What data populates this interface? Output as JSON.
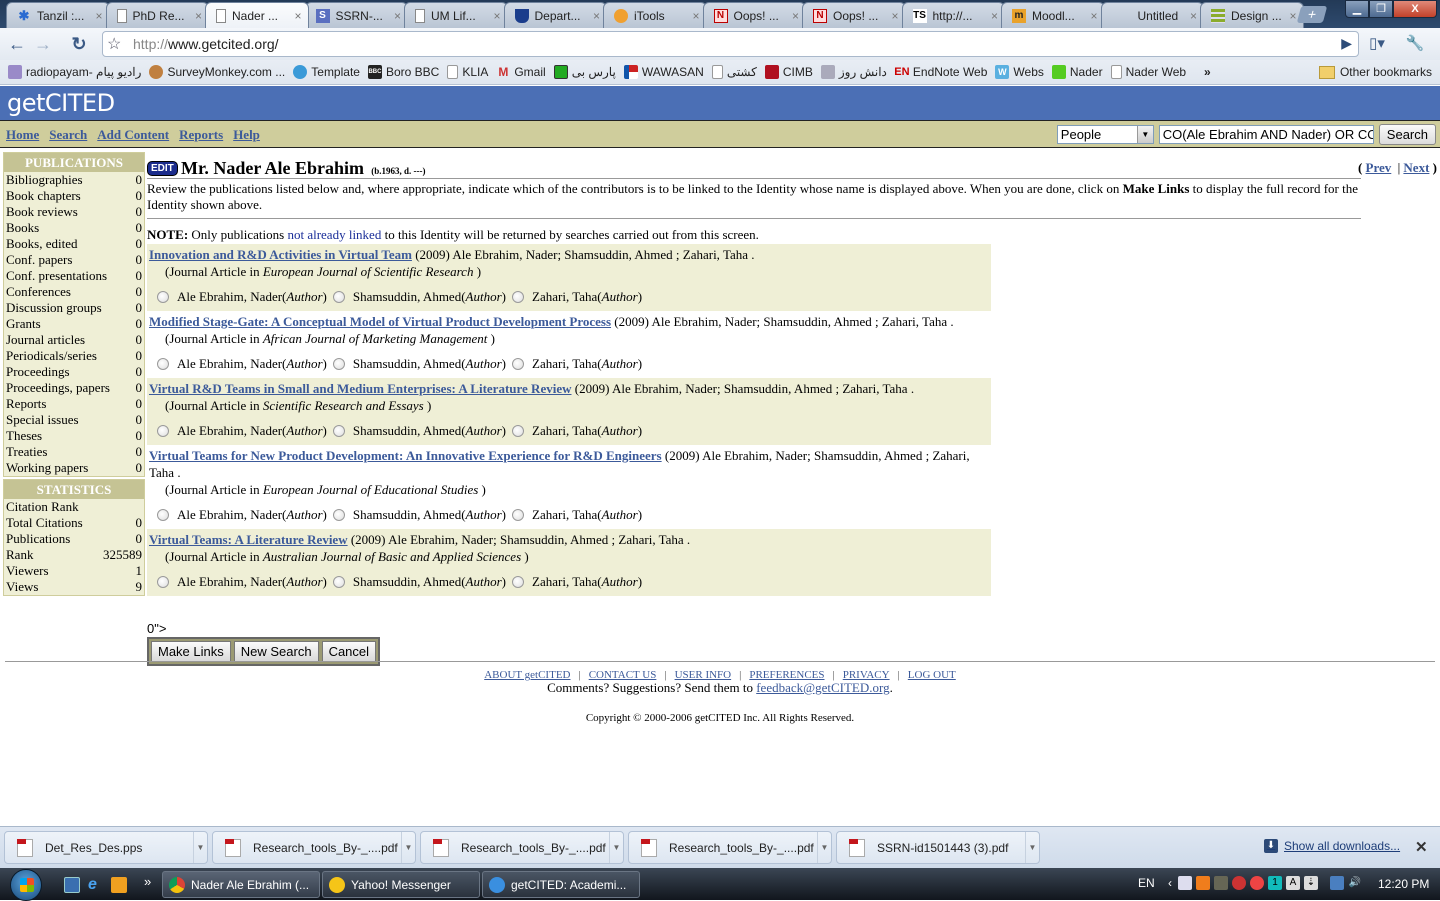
{
  "browser": {
    "tabs": [
      {
        "label": "Tanzil :...",
        "icon": "tanzil-icon",
        "active": false
      },
      {
        "label": "PhD Re...",
        "icon": "page-icon",
        "active": false
      },
      {
        "label": "Nader ...",
        "icon": "page-icon",
        "active": true
      },
      {
        "label": "SSRN-...",
        "icon": "ssrn-icon",
        "active": false
      },
      {
        "label": "UM Lif...",
        "icon": "page-icon",
        "active": false
      },
      {
        "label": "Depart...",
        "icon": "shield-icon",
        "active": false
      },
      {
        "label": "iTools",
        "icon": "itools-icon",
        "active": false
      },
      {
        "label": "Oops! ...",
        "icon": "nb-icon",
        "active": false
      },
      {
        "label": "Oops! ...",
        "icon": "nb-icon",
        "active": false
      },
      {
        "label": "http://...",
        "icon": "ts-icon",
        "active": false
      },
      {
        "label": "Moodl...",
        "icon": "moodle-icon",
        "active": false
      },
      {
        "label": "Untitled",
        "icon": "none",
        "active": false
      },
      {
        "label": "Design ...",
        "icon": "design-icon",
        "active": false
      }
    ],
    "new_tab_label": "+",
    "window_controls": {
      "minimize": "▁",
      "maximize": "❐",
      "close": "X"
    },
    "url_scheme": "http://",
    "url_rest": "www.getcited.org/",
    "bookmarks": [
      {
        "label": "radiopayam- رادیو پیام",
        "icon": "radio-icon"
      },
      {
        "label": "SurveyMonkey.com ...",
        "icon": "monkey-icon"
      },
      {
        "label": "Template",
        "icon": "template-icon"
      },
      {
        "label": "Boro BBC",
        "icon": "bbc-icon"
      },
      {
        "label": "KLIA",
        "icon": "page-icon"
      },
      {
        "label": "Gmail",
        "icon": "gmail-icon"
      },
      {
        "label": "پارس بی",
        "icon": "joomla-icon"
      },
      {
        "label": "WAWASAN",
        "icon": "flag-icon"
      },
      {
        "label": "کشتی",
        "icon": "page-icon"
      },
      {
        "label": "CIMB",
        "icon": "cimb-icon"
      },
      {
        "label": "دانش روز",
        "icon": "image-icon"
      },
      {
        "label": "EndNote Web",
        "icon": "endnote-icon"
      },
      {
        "label": "Webs",
        "icon": "webs-icon"
      },
      {
        "label": "Nader",
        "icon": "nader-icon"
      },
      {
        "label": "Nader Web",
        "icon": "page-icon"
      }
    ],
    "bookmarks_more": "»",
    "other_bookmarks": "Other bookmarks"
  },
  "site": {
    "logo": "getCITED",
    "nav": [
      "Home",
      "Search",
      "Add Content",
      "Reports",
      "Help"
    ],
    "search": {
      "category": "People",
      "query": "CO(Ale Ebrahim AND Nader) OR CO",
      "button": "Search"
    }
  },
  "sidebar": {
    "publications_header": "PUBLICATIONS",
    "publications": [
      {
        "label": "Bibliographies",
        "count": "0"
      },
      {
        "label": "Book chapters",
        "count": "0"
      },
      {
        "label": "Book reviews",
        "count": "0"
      },
      {
        "label": "Books",
        "count": "0"
      },
      {
        "label": "Books, edited",
        "count": "0"
      },
      {
        "label": "Conf. papers",
        "count": "0"
      },
      {
        "label": "Conf. presentations",
        "count": "0"
      },
      {
        "label": "Conferences",
        "count": "0"
      },
      {
        "label": "Discussion groups",
        "count": "0"
      },
      {
        "label": "Grants",
        "count": "0"
      },
      {
        "label": "Journal articles",
        "count": "0"
      },
      {
        "label": "Periodicals/series",
        "count": "0"
      },
      {
        "label": "Proceedings",
        "count": "0"
      },
      {
        "label": "Proceedings, papers",
        "count": "0"
      },
      {
        "label": "Reports",
        "count": "0"
      },
      {
        "label": "Special issues",
        "count": "0"
      },
      {
        "label": "Theses",
        "count": "0"
      },
      {
        "label": "Treaties",
        "count": "0"
      },
      {
        "label": "Working papers",
        "count": "0"
      }
    ],
    "statistics_header": "STATISTICS",
    "statistics": [
      {
        "label": "Citation Rank",
        "count": ""
      },
      {
        "label": "Total Citations",
        "count": "0"
      },
      {
        "label": "Publications",
        "count": "0"
      },
      {
        "label": "Rank",
        "count": "325589"
      },
      {
        "label": "Viewers",
        "count": "1"
      },
      {
        "label": "Views",
        "count": "9"
      }
    ]
  },
  "main": {
    "edit_badge": "EDIT",
    "person_name": "Mr. Nader Ale Ebrahim",
    "dates": "(b.1963, d. ---)",
    "prev_open": "(",
    "prev": "Prev",
    "separator": "|",
    "next": "Next",
    "prev_close": ")",
    "intro_a": "Review the publications listed below and, where appropriate, indicate which of the contributors is to be linked to the Identity whose name is displayed above. When you are done, click on ",
    "intro_bold": "Make Links",
    "intro_b": " to display the full record for the Identity shown above.",
    "note_label": "NOTE:",
    "note_a": " Only publications ",
    "note_highlight": "not already linked",
    "note_b": " to this Identity will be returned by searches carried out from this screen.",
    "publications": [
      {
        "title": "Innovation and R&D Activities in Virtual Team",
        "year": "(2009)",
        "authors": "Ale Ebrahim, Nader; Shamsuddin, Ahmed ; Zahari, Taha .",
        "type_prefix": "(Journal Article in ",
        "journal": "European Journal of Scientific Research",
        "type_suffix": " )",
        "contributors": [
          {
            "name": "Ale Ebrahim, Nader",
            "role": "Author",
            "selected": false
          },
          {
            "name": "Shamsuddin, Ahmed",
            "role": "Author",
            "selected": false
          },
          {
            "name": "Zahari, Taha",
            "role": "Author",
            "selected": false
          }
        ]
      },
      {
        "title": "Modified Stage-Gate: A Conceptual Model of Virtual Product Development Process",
        "year": "(2009)",
        "authors": "Ale Ebrahim, Nader; Shamsuddin, Ahmed ; Zahari, Taha .",
        "type_prefix": "(Journal Article in ",
        "journal": "African Journal of Marketing Management",
        "type_suffix": " )",
        "contributors": [
          {
            "name": "Ale Ebrahim, Nader",
            "role": "Author",
            "selected": false
          },
          {
            "name": "Shamsuddin, Ahmed",
            "role": "Author",
            "selected": false
          },
          {
            "name": "Zahari, Taha",
            "role": "Author",
            "selected": false
          }
        ]
      },
      {
        "title": "Virtual R&D Teams in Small and Medium Enterprises: A Literature Review",
        "year": "(2009)",
        "authors": "Ale Ebrahim, Nader; Shamsuddin, Ahmed ; Zahari, Taha .",
        "type_prefix": "(Journal Article in ",
        "journal": "Scientific Research and Essays",
        "type_suffix": " )",
        "contributors": [
          {
            "name": "Ale Ebrahim, Nader",
            "role": "Author",
            "selected": false
          },
          {
            "name": "Shamsuddin, Ahmed",
            "role": "Author",
            "selected": false
          },
          {
            "name": "Zahari, Taha",
            "role": "Author",
            "selected": false
          }
        ]
      },
      {
        "title": "Virtual Teams for New Product Development: An Innovative Experience for R&D Engineers",
        "year": "(2009)",
        "authors": "Ale Ebrahim, Nader; Shamsuddin, Ahmed ; Zahari, Taha .",
        "type_prefix": "(Journal Article in ",
        "journal": "European Journal of Educational Studies",
        "type_suffix": " )",
        "contributors": [
          {
            "name": "Ale Ebrahim, Nader",
            "role": "Author",
            "selected": false
          },
          {
            "name": "Shamsuddin, Ahmed",
            "role": "Author",
            "selected": false
          },
          {
            "name": "Zahari, Taha",
            "role": "Author",
            "selected": false
          }
        ]
      },
      {
        "title": "Virtual Teams: A Literature Review",
        "year": "(2009)",
        "authors": "Ale Ebrahim, Nader; Shamsuddin, Ahmed ; Zahari, Taha .",
        "type_prefix": "(Journal Article in ",
        "journal": "Australian Journal of Basic and Applied Sciences",
        "type_suffix": " )",
        "contributors": [
          {
            "name": "Ale Ebrahim, Nader",
            "role": "Author",
            "selected": false
          },
          {
            "name": "Shamsuddin, Ahmed",
            "role": "Author",
            "selected": false
          },
          {
            "name": "Zahari, Taha",
            "role": "Author",
            "selected": false
          }
        ]
      }
    ],
    "stray_text": "0\">",
    "buttons": {
      "make_links": "Make Links",
      "new_search": "New Search",
      "cancel": "Cancel"
    }
  },
  "footer": {
    "links": [
      "ABOUT getCITED",
      "CONTACT US",
      "USER INFO",
      "PREFERENCES",
      "PRIVACY",
      "LOG OUT"
    ],
    "comments_text": "Comments? Suggestions? Send them to ",
    "feedback_email": "feedback@getCITED.org",
    "comments_end": ".",
    "copyright": "Copyright © 2000-2006 getCITED Inc. All Rights Reserved."
  },
  "downloads": {
    "items": [
      {
        "label": "Det_Res_Des.pps",
        "icon": "pps-icon"
      },
      {
        "label": "Research_tools_By-_....pdf",
        "icon": "pdf-icon"
      },
      {
        "label": "Research_tools_By-_....pdf",
        "icon": "pdf-icon"
      },
      {
        "label": "Research_tools_By-_....pdf",
        "icon": "pdf-icon"
      },
      {
        "label": "SSRN-id1501443 (3).pdf",
        "icon": "pdf-icon"
      }
    ],
    "show_all": "Show all downloads...",
    "close": "✕"
  },
  "taskbar": {
    "quicklaunch_more": "»",
    "tasks": [
      {
        "label": "Nader Ale Ebrahim (...",
        "icon": "chrome-icon",
        "active": true
      },
      {
        "label": "Yahoo! Messenger",
        "icon": "yahoo-messenger-icon",
        "active": false
      },
      {
        "label": "getCITED: Academi...",
        "icon": "ie-icon",
        "active": false
      }
    ],
    "language": "EN",
    "tray_chevron": "‹",
    "time": "12:20 PM"
  }
}
